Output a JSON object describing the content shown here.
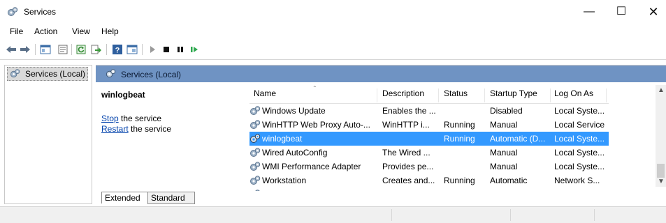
{
  "window": {
    "title": "Services"
  },
  "menu": [
    "File",
    "Action",
    "View",
    "Help"
  ],
  "tree": {
    "root_label": "Services (Local)"
  },
  "pane": {
    "header": "Services (Local)"
  },
  "detail": {
    "service_name": "winlogbeat",
    "stop_link": "Stop",
    "stop_rest": " the service",
    "restart_link": "Restart",
    "restart_rest": " the service"
  },
  "tabs": [
    "Extended",
    "Standard"
  ],
  "columns": [
    "Name",
    "Description",
    "Status",
    "Startup Type",
    "Log On As"
  ],
  "rows": [
    {
      "name": "Windows Update",
      "description": "Enables the ...",
      "status": "",
      "startup": "Disabled",
      "logon": "Local Syste..."
    },
    {
      "name": "WinHTTP Web Proxy Auto-...",
      "description": "WinHTTP i...",
      "status": "Running",
      "startup": "Manual",
      "logon": "Local Service"
    },
    {
      "name": "winlogbeat",
      "description": "",
      "status": "Running",
      "startup": "Automatic (D...",
      "logon": "Local Syste...",
      "selected": true
    },
    {
      "name": "Wired AutoConfig",
      "description": "The Wired ...",
      "status": "",
      "startup": "Manual",
      "logon": "Local Syste..."
    },
    {
      "name": "WMI Performance Adapter",
      "description": "Provides pe...",
      "status": "",
      "startup": "Manual",
      "logon": "Local Syste..."
    },
    {
      "name": "Workstation",
      "description": "Creates and...",
      "status": "Running",
      "startup": "Automatic",
      "logon": "Network S..."
    }
  ],
  "colors": {
    "pane_header": "#6f93c3",
    "selection": "#3399ff",
    "link": "#0645ad"
  },
  "icons": {
    "app": "services-gear-icon",
    "toolbar": [
      "back-arrow-icon",
      "forward-arrow-icon",
      "console-tree-icon",
      "properties-icon",
      "refresh-icon",
      "export-list-icon",
      "help-icon",
      "view-icon",
      "play-icon",
      "stop-icon",
      "pause-icon",
      "restart-icon"
    ]
  }
}
